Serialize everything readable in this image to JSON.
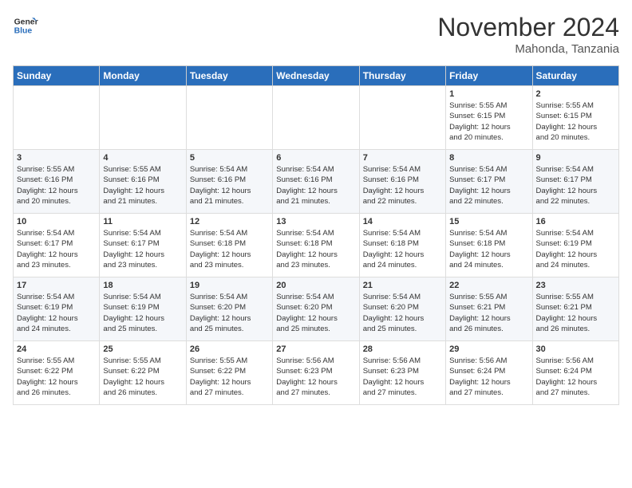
{
  "header": {
    "logo_general": "General",
    "logo_blue": "Blue",
    "month": "November 2024",
    "location": "Mahonda, Tanzania"
  },
  "weekdays": [
    "Sunday",
    "Monday",
    "Tuesday",
    "Wednesday",
    "Thursday",
    "Friday",
    "Saturday"
  ],
  "weeks": [
    [
      {
        "day": "",
        "detail": ""
      },
      {
        "day": "",
        "detail": ""
      },
      {
        "day": "",
        "detail": ""
      },
      {
        "day": "",
        "detail": ""
      },
      {
        "day": "",
        "detail": ""
      },
      {
        "day": "1",
        "detail": "Sunrise: 5:55 AM\nSunset: 6:15 PM\nDaylight: 12 hours\nand 20 minutes."
      },
      {
        "day": "2",
        "detail": "Sunrise: 5:55 AM\nSunset: 6:15 PM\nDaylight: 12 hours\nand 20 minutes."
      }
    ],
    [
      {
        "day": "3",
        "detail": "Sunrise: 5:55 AM\nSunset: 6:16 PM\nDaylight: 12 hours\nand 20 minutes."
      },
      {
        "day": "4",
        "detail": "Sunrise: 5:55 AM\nSunset: 6:16 PM\nDaylight: 12 hours\nand 21 minutes."
      },
      {
        "day": "5",
        "detail": "Sunrise: 5:54 AM\nSunset: 6:16 PM\nDaylight: 12 hours\nand 21 minutes."
      },
      {
        "day": "6",
        "detail": "Sunrise: 5:54 AM\nSunset: 6:16 PM\nDaylight: 12 hours\nand 21 minutes."
      },
      {
        "day": "7",
        "detail": "Sunrise: 5:54 AM\nSunset: 6:16 PM\nDaylight: 12 hours\nand 22 minutes."
      },
      {
        "day": "8",
        "detail": "Sunrise: 5:54 AM\nSunset: 6:17 PM\nDaylight: 12 hours\nand 22 minutes."
      },
      {
        "day": "9",
        "detail": "Sunrise: 5:54 AM\nSunset: 6:17 PM\nDaylight: 12 hours\nand 22 minutes."
      }
    ],
    [
      {
        "day": "10",
        "detail": "Sunrise: 5:54 AM\nSunset: 6:17 PM\nDaylight: 12 hours\nand 23 minutes."
      },
      {
        "day": "11",
        "detail": "Sunrise: 5:54 AM\nSunset: 6:17 PM\nDaylight: 12 hours\nand 23 minutes."
      },
      {
        "day": "12",
        "detail": "Sunrise: 5:54 AM\nSunset: 6:18 PM\nDaylight: 12 hours\nand 23 minutes."
      },
      {
        "day": "13",
        "detail": "Sunrise: 5:54 AM\nSunset: 6:18 PM\nDaylight: 12 hours\nand 23 minutes."
      },
      {
        "day": "14",
        "detail": "Sunrise: 5:54 AM\nSunset: 6:18 PM\nDaylight: 12 hours\nand 24 minutes."
      },
      {
        "day": "15",
        "detail": "Sunrise: 5:54 AM\nSunset: 6:18 PM\nDaylight: 12 hours\nand 24 minutes."
      },
      {
        "day": "16",
        "detail": "Sunrise: 5:54 AM\nSunset: 6:19 PM\nDaylight: 12 hours\nand 24 minutes."
      }
    ],
    [
      {
        "day": "17",
        "detail": "Sunrise: 5:54 AM\nSunset: 6:19 PM\nDaylight: 12 hours\nand 24 minutes."
      },
      {
        "day": "18",
        "detail": "Sunrise: 5:54 AM\nSunset: 6:19 PM\nDaylight: 12 hours\nand 25 minutes."
      },
      {
        "day": "19",
        "detail": "Sunrise: 5:54 AM\nSunset: 6:20 PM\nDaylight: 12 hours\nand 25 minutes."
      },
      {
        "day": "20",
        "detail": "Sunrise: 5:54 AM\nSunset: 6:20 PM\nDaylight: 12 hours\nand 25 minutes."
      },
      {
        "day": "21",
        "detail": "Sunrise: 5:54 AM\nSunset: 6:20 PM\nDaylight: 12 hours\nand 25 minutes."
      },
      {
        "day": "22",
        "detail": "Sunrise: 5:55 AM\nSunset: 6:21 PM\nDaylight: 12 hours\nand 26 minutes."
      },
      {
        "day": "23",
        "detail": "Sunrise: 5:55 AM\nSunset: 6:21 PM\nDaylight: 12 hours\nand 26 minutes."
      }
    ],
    [
      {
        "day": "24",
        "detail": "Sunrise: 5:55 AM\nSunset: 6:22 PM\nDaylight: 12 hours\nand 26 minutes."
      },
      {
        "day": "25",
        "detail": "Sunrise: 5:55 AM\nSunset: 6:22 PM\nDaylight: 12 hours\nand 26 minutes."
      },
      {
        "day": "26",
        "detail": "Sunrise: 5:55 AM\nSunset: 6:22 PM\nDaylight: 12 hours\nand 27 minutes."
      },
      {
        "day": "27",
        "detail": "Sunrise: 5:56 AM\nSunset: 6:23 PM\nDaylight: 12 hours\nand 27 minutes."
      },
      {
        "day": "28",
        "detail": "Sunrise: 5:56 AM\nSunset: 6:23 PM\nDaylight: 12 hours\nand 27 minutes."
      },
      {
        "day": "29",
        "detail": "Sunrise: 5:56 AM\nSunset: 6:24 PM\nDaylight: 12 hours\nand 27 minutes."
      },
      {
        "day": "30",
        "detail": "Sunrise: 5:56 AM\nSunset: 6:24 PM\nDaylight: 12 hours\nand 27 minutes."
      }
    ]
  ]
}
